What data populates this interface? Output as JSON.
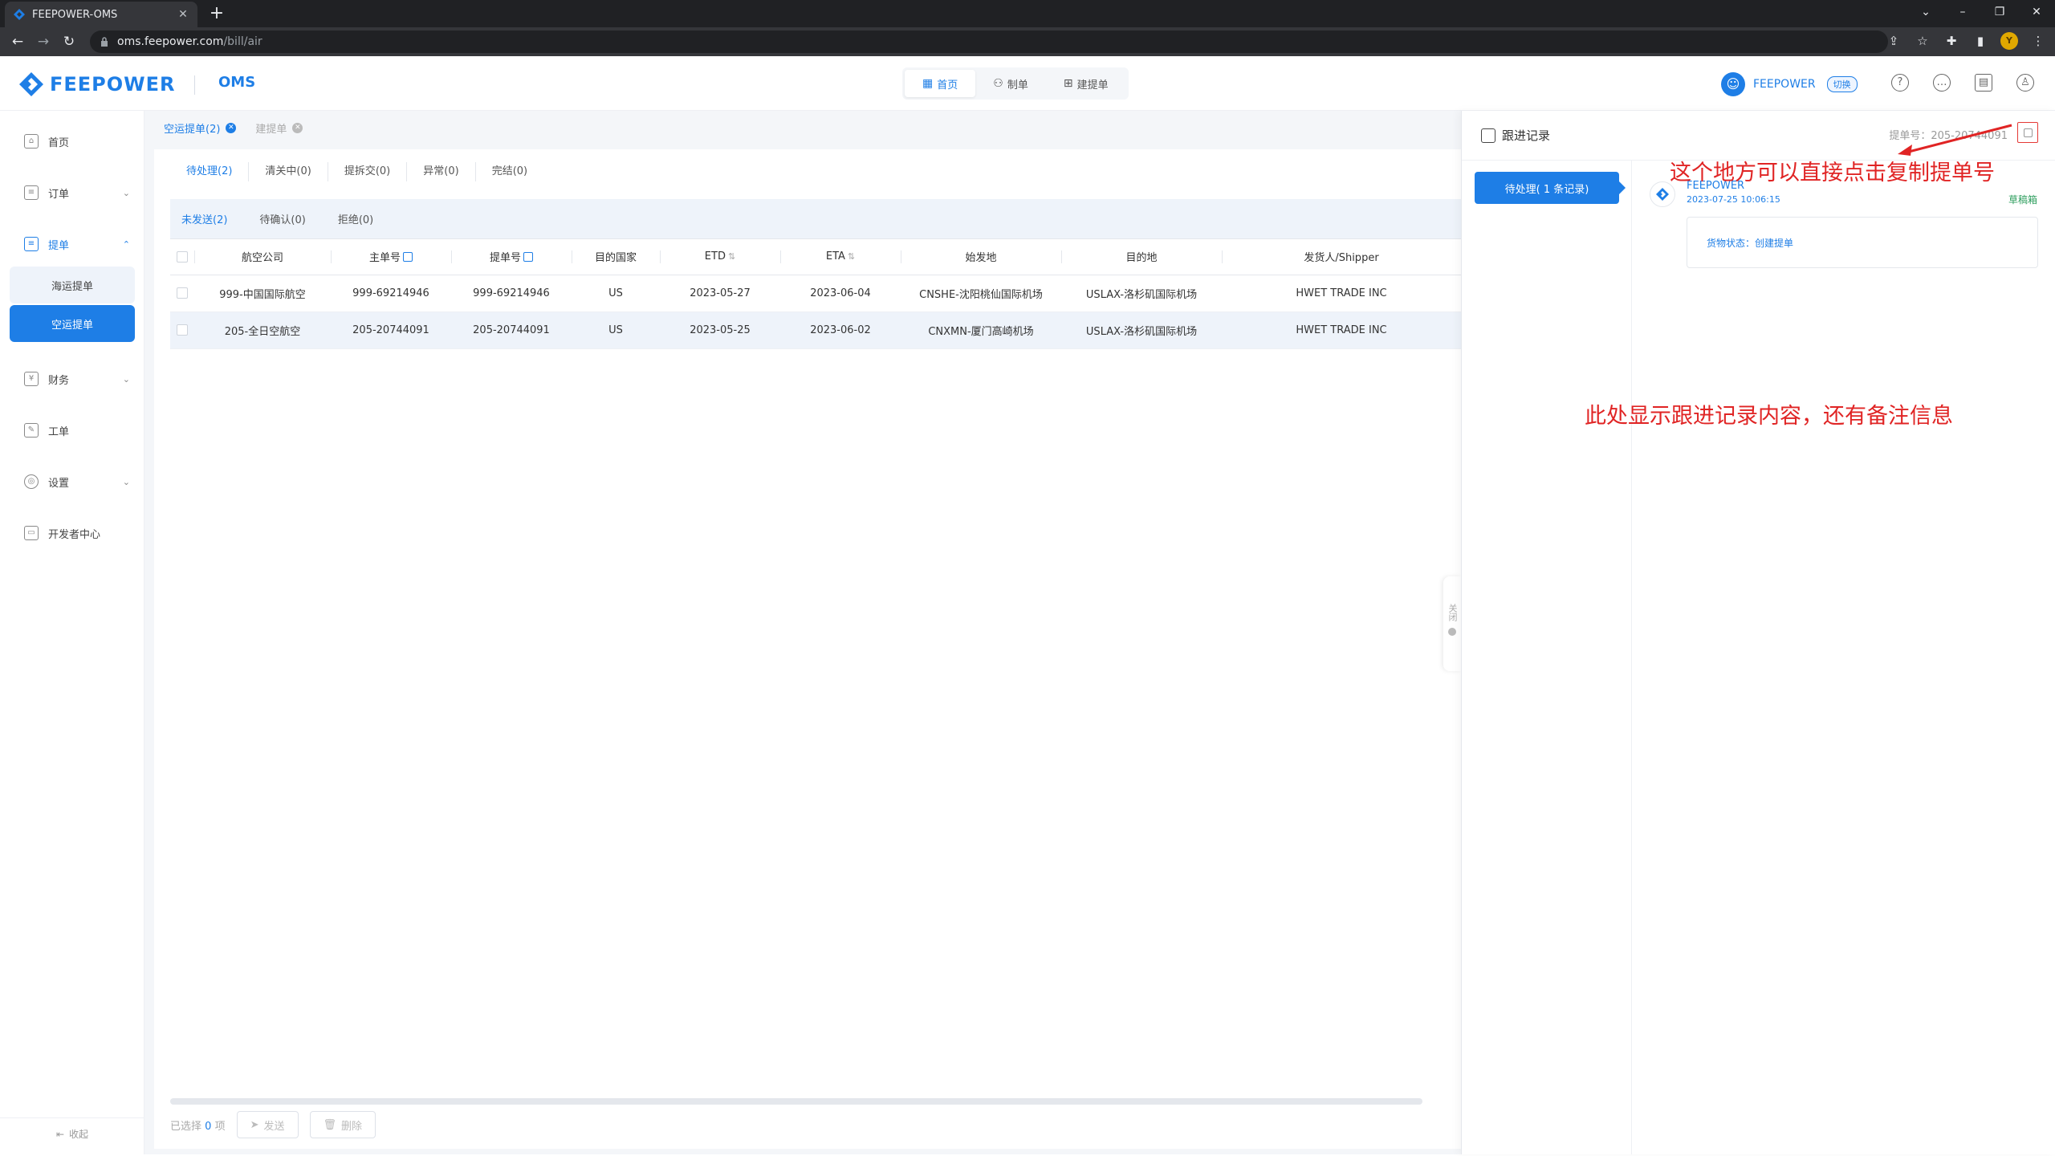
{
  "browser": {
    "tab_title": "FEEPOWER-OMS",
    "tab_close": "✕",
    "new_tab": "+",
    "url_host": "oms.feepower.com",
    "url_path": "/bill/air",
    "profile_initial": "Y"
  },
  "header": {
    "brand": "FEEPOWER",
    "system": "OMS",
    "nav": [
      {
        "label": "首页",
        "icon": "grid-icon"
      },
      {
        "label": "制单",
        "icon": "person-icon"
      },
      {
        "label": "建提单",
        "icon": "add-doc-icon"
      }
    ],
    "user_name": "FEEPOWER",
    "switch_label": "切换"
  },
  "sidebar": {
    "items": [
      {
        "label": "首页",
        "icon": "home-icon"
      },
      {
        "label": "订单",
        "icon": "order-icon"
      },
      {
        "label": "提单",
        "icon": "bill-icon"
      },
      {
        "label": "财务",
        "icon": "finance-icon"
      },
      {
        "label": "工单",
        "icon": "ticket-icon"
      },
      {
        "label": "设置",
        "icon": "settings-icon"
      },
      {
        "label": "开发者中心",
        "icon": "developer-icon"
      }
    ],
    "subitems": [
      {
        "label": "海运提单"
      },
      {
        "label": "空运提单"
      }
    ],
    "collapse_label": "收起"
  },
  "breadcrumbs": [
    {
      "label": "空运提单(2)"
    },
    {
      "label": "建提单"
    }
  ],
  "status_tabs": [
    {
      "label": "待处理(2)"
    },
    {
      "label": "清关中(0)"
    },
    {
      "label": "提拆交(0)"
    },
    {
      "label": "异常(0)"
    },
    {
      "label": "完结(0)"
    }
  ],
  "sub_tabs": [
    {
      "label": "未发送(2)"
    },
    {
      "label": "待确认(0)"
    },
    {
      "label": "拒绝(0)"
    }
  ],
  "table": {
    "headers": [
      "航空公司",
      "主单号",
      "提单号",
      "目的国家",
      "ETD",
      "ETA",
      "始发地",
      "目的地",
      "发货人/Shipper"
    ],
    "rows": [
      [
        "999-中国国际航空",
        "999-69214946",
        "999-69214946",
        "US",
        "2023-05-27",
        "2023-06-04",
        "CNSHE-沈阳桃仙国际机场",
        "USLAX-洛杉矶国际机场",
        "HWET TRADE INC"
      ],
      [
        "205-全日空航空",
        "205-20744091",
        "205-20744091",
        "US",
        "2023-05-25",
        "2023-06-02",
        "CNXMN-厦门高崎机场",
        "USLAX-洛杉矶国际机场",
        "HWET TRADE INC"
      ]
    ]
  },
  "footer": {
    "selected_prefix": "已选择",
    "selected_count": "0",
    "selected_suffix": "项",
    "send_label": "发送",
    "delete_label": "删除"
  },
  "panel": {
    "title": "跟进记录",
    "bill_no": "提单号：205-20744091",
    "collapse_label": "关闭",
    "pending_label": "待处理( 1 条记录)",
    "record": {
      "name": "FEEPOWER",
      "time": "2023-07-25 10:06:15",
      "status": "草稿箱",
      "content": "货物状态：创建提单"
    }
  },
  "annotations": {
    "copy_hint": "这个地方可以直接点击复制提单号",
    "record_hint": "此处显示跟进记录内容，还有备注信息"
  },
  "colors": {
    "primary": "#1e7ee6",
    "annotation": "#e02424",
    "status_green": "#2e9e5e"
  }
}
